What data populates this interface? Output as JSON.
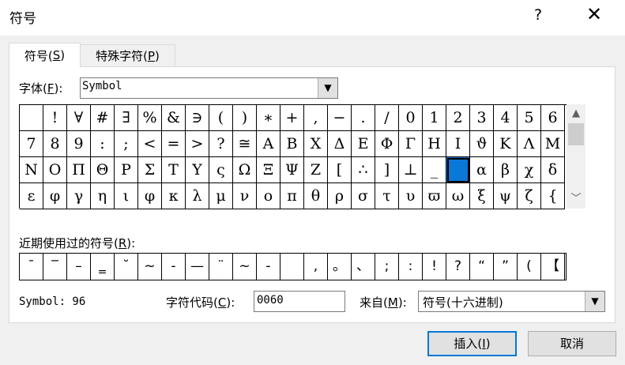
{
  "window": {
    "title": "符号",
    "help_label": "?",
    "close_label": "✕"
  },
  "tabs": [
    {
      "label_pre": "符号(",
      "key": "S",
      "label_post": ")"
    },
    {
      "label_pre": "特殊字符(",
      "key": "P",
      "label_post": ")"
    }
  ],
  "font": {
    "label_pre": "字体(",
    "key": "F",
    "label_post": "):",
    "value": "Symbol"
  },
  "symbols": [
    [
      "",
      "!",
      "∀",
      "#",
      "∃",
      "%",
      "&",
      "∋",
      "(",
      ")",
      "∗",
      "+",
      ",",
      "−",
      ".",
      "/",
      "0",
      "1",
      "2",
      "3",
      "4",
      "5",
      "6"
    ],
    [
      "7",
      "8",
      "9",
      ":",
      ";",
      "<",
      "=",
      ">",
      "?",
      "≅",
      "Α",
      "Β",
      "Χ",
      "Δ",
      "Ε",
      "Φ",
      "Γ",
      "Η",
      "Ι",
      "ϑ",
      "Κ",
      "Λ",
      "Μ"
    ],
    [
      "Ν",
      "Ο",
      "Π",
      "Θ",
      "Ρ",
      "Σ",
      "Τ",
      "Υ",
      "ς",
      "Ω",
      "Ξ",
      "Ψ",
      "Ζ",
      "[",
      "∴",
      "]",
      "⊥",
      "_",
      "",
      "α",
      "β",
      "χ",
      "δ"
    ],
    [
      "ε",
      "φ",
      "γ",
      "η",
      "ι",
      "φ",
      "κ",
      "λ",
      "μ",
      "ν",
      "ο",
      "π",
      "θ",
      "ρ",
      "σ",
      "τ",
      "υ",
      "ϖ",
      "ω",
      "ξ",
      "ψ",
      "ζ",
      "{"
    ]
  ],
  "scroll": {
    "up": "▲",
    "down": "﹀"
  },
  "recent": {
    "label_pre": "近期使用过的符号(",
    "key": "R",
    "label_post": "):",
    "items": [
      "¯",
      "‾",
      "–",
      "‗",
      "˘",
      "~",
      "-",
      "—",
      "¨",
      "~",
      "-",
      "",
      ",",
      "。",
      "、",
      ";",
      ":",
      "!",
      "?",
      "“",
      "”",
      "(",
      "【"
    ]
  },
  "status": {
    "font_name": "Symbol: 96",
    "code_label_pre": "字符代码(",
    "code_key": "C",
    "code_label_post": "):",
    "code_value": "0060",
    "from_label_pre": "来自(",
    "from_key": "M",
    "from_label_post": "):",
    "from_value": "符号(十六进制)"
  },
  "buttons": {
    "insert_pre": "插入(",
    "insert_key": "I",
    "insert_post": ")",
    "cancel": "取消"
  },
  "colors": {
    "selection": "#0a78d7",
    "default_button_border": "#0078d7"
  }
}
